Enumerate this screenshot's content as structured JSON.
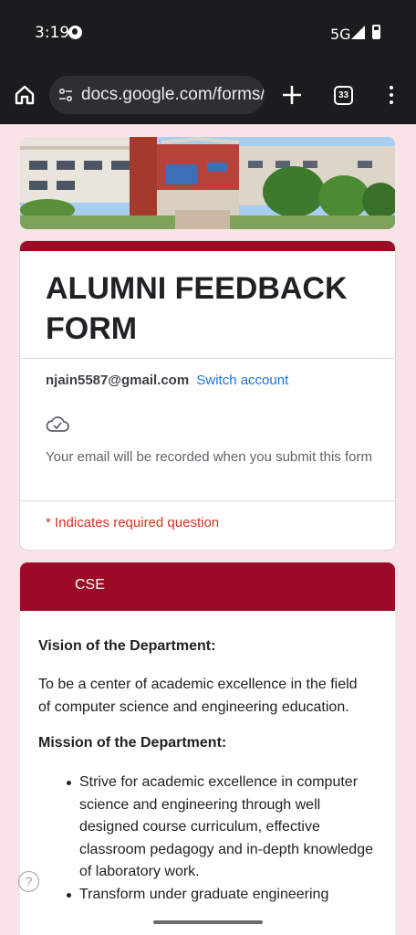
{
  "status_bar": {
    "time": "3:19",
    "network": "5G",
    "icons": [
      "app-notification-icon",
      "signal-icon",
      "battery-icon"
    ]
  },
  "browser": {
    "url": "docs.google.com/forms/",
    "tab_count": "33",
    "icons": [
      "home-icon",
      "site-settings-icon",
      "new-tab-icon",
      "tab-switcher-icon",
      "more-menu-icon"
    ]
  },
  "form": {
    "title": "ALUMNI FEEDBACK FORM",
    "account_email": "njain5587@gmail.com",
    "switch_account": "Switch account",
    "record_notice": "Your email will be recorded when you submit this form",
    "required_note": "* Indicates required question"
  },
  "section": {
    "label": "CSE",
    "vision_heading": "Vision of the Department:",
    "vision_text": "To be a center of academic excellence in the field of computer science and engineering education.",
    "mission_heading": "Mission of the Department:",
    "mission_items": [
      "Strive for academic excellence in computer science and engineering through well designed course curriculum, effective classroom pedagogy and in-depth knowledge of laboratory work.",
      "Transform under graduate engineering"
    ]
  },
  "help": {
    "label": "?"
  },
  "colors": {
    "accent": "#9b0a26",
    "page_background": "#f8e4e6",
    "link": "#1a73e8",
    "required": "#d93025"
  }
}
